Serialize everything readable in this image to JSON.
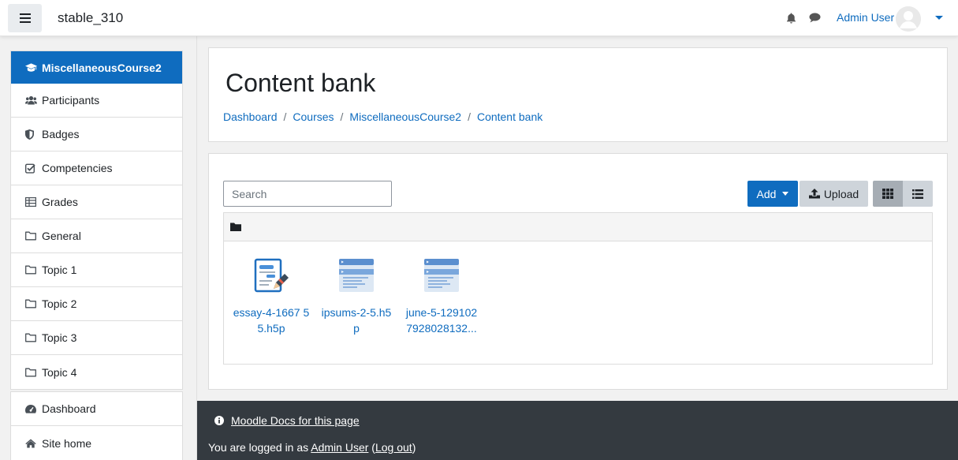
{
  "navbar": {
    "site_name": "stable_310",
    "user_name": "Admin User"
  },
  "drawer": {
    "course_items": [
      {
        "label": "MiscellaneousCourse2",
        "icon": "graduation-cap-icon"
      },
      {
        "label": "Participants",
        "icon": "users-icon"
      },
      {
        "label": "Badges",
        "icon": "shield-icon"
      },
      {
        "label": "Competencies",
        "icon": "check-square-icon"
      },
      {
        "label": "Grades",
        "icon": "table-icon"
      },
      {
        "label": "General",
        "icon": "folder-icon"
      },
      {
        "label": "Topic 1",
        "icon": "folder-icon"
      },
      {
        "label": "Topic 2",
        "icon": "folder-icon"
      },
      {
        "label": "Topic 3",
        "icon": "folder-icon"
      },
      {
        "label": "Topic 4",
        "icon": "folder-icon"
      }
    ],
    "site_items": [
      {
        "label": "Dashboard",
        "icon": "tachometer-icon"
      },
      {
        "label": "Site home",
        "icon": "home-icon"
      }
    ]
  },
  "header": {
    "title": "Content bank",
    "breadcrumb": [
      "Dashboard",
      "Courses",
      "MiscellaneousCourse2",
      "Content bank"
    ],
    "separator": "/"
  },
  "toolbar": {
    "search_placeholder": "Search",
    "add_label": "Add",
    "upload_label": "Upload"
  },
  "files": [
    {
      "name": "essay-4-166755.h5p",
      "display": "essay-4-1667 55.h5p",
      "icon": "essay-document-icon"
    },
    {
      "name": "ipsums-2-5.h5p",
      "display": "ipsums-2-5.h5 p",
      "icon": "h5p-content-icon"
    },
    {
      "name": "june-5-1291027928028132...",
      "display": "june-5-129102 7928028132...",
      "icon": "h5p-content-icon"
    }
  ],
  "footer": {
    "docs_link": "Moodle Docs for this page",
    "login_prefix": "You are logged in as ",
    "login_user": "Admin User",
    "logout_label": "Log out"
  },
  "colors": {
    "accent": "#0f6cbf",
    "footer_bg": "#343a40"
  }
}
